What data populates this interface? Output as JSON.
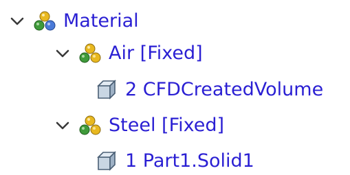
{
  "tree": {
    "root": {
      "label": "Material",
      "expanded": true,
      "icon": "material-group-icon",
      "children": [
        {
          "label": "Air [Fixed]",
          "expanded": true,
          "icon": "material-assignment-icon",
          "children": [
            {
              "label": "2 CFDCreatedVolume",
              "icon": "body-volume-icon"
            }
          ]
        },
        {
          "label": "Steel [Fixed]",
          "expanded": true,
          "icon": "material-assignment-icon",
          "children": [
            {
              "label": "1 Part1.Solid1",
              "icon": "body-volume-icon"
            }
          ]
        }
      ]
    },
    "colors": {
      "label": "#2a1fd3",
      "chevron": "#3a3a3a",
      "sphere_yellow": "#e8b820",
      "sphere_green": "#3f9a3a",
      "sphere_blue": "#4a7ad8",
      "cube": "#6c8aa8"
    }
  }
}
